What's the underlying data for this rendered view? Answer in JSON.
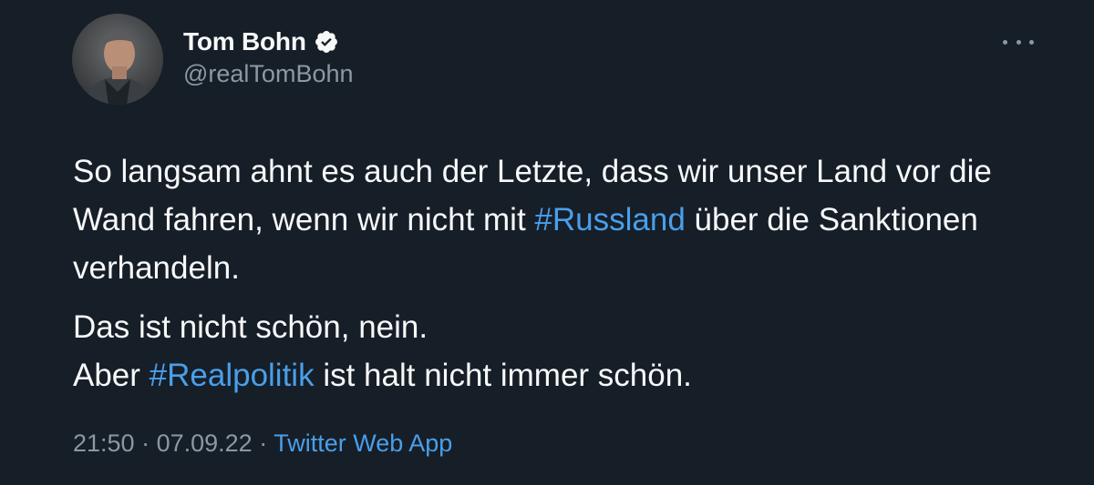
{
  "author": {
    "display_name": "Tom Bohn",
    "handle": "@realTomBohn",
    "verified": true,
    "avatar_icon": "profile-photo"
  },
  "tweet": {
    "paragraphs": [
      {
        "segments": [
          {
            "text": "So langsam ahnt es auch der Letzte, dass wir unser Land vor die Wand fahren, wenn wir nicht mit ",
            "type": "text"
          },
          {
            "text": "#Russland",
            "type": "hashtag"
          },
          {
            "text": " über die Sanktionen verhandeln.",
            "type": "text"
          }
        ]
      },
      {
        "segments": [
          {
            "text": "Das ist nicht schön, nein.",
            "type": "text"
          },
          {
            "text": "Aber ",
            "type": "text"
          },
          {
            "text": "#Realpolitik",
            "type": "hashtag"
          },
          {
            "text": " ist halt nicht immer schön.",
            "type": "text"
          }
        ]
      }
    ]
  },
  "meta": {
    "time": "21:50",
    "separator": " · ",
    "date": "07.09.22",
    "source": "Twitter Web App"
  },
  "icons": {
    "verified": "verified-badge-icon",
    "more": "more-options-icon"
  },
  "colors": {
    "background": "#15202b",
    "text": "#f7f9f9",
    "secondary": "#8b98a5",
    "link": "#4a9fe8"
  }
}
